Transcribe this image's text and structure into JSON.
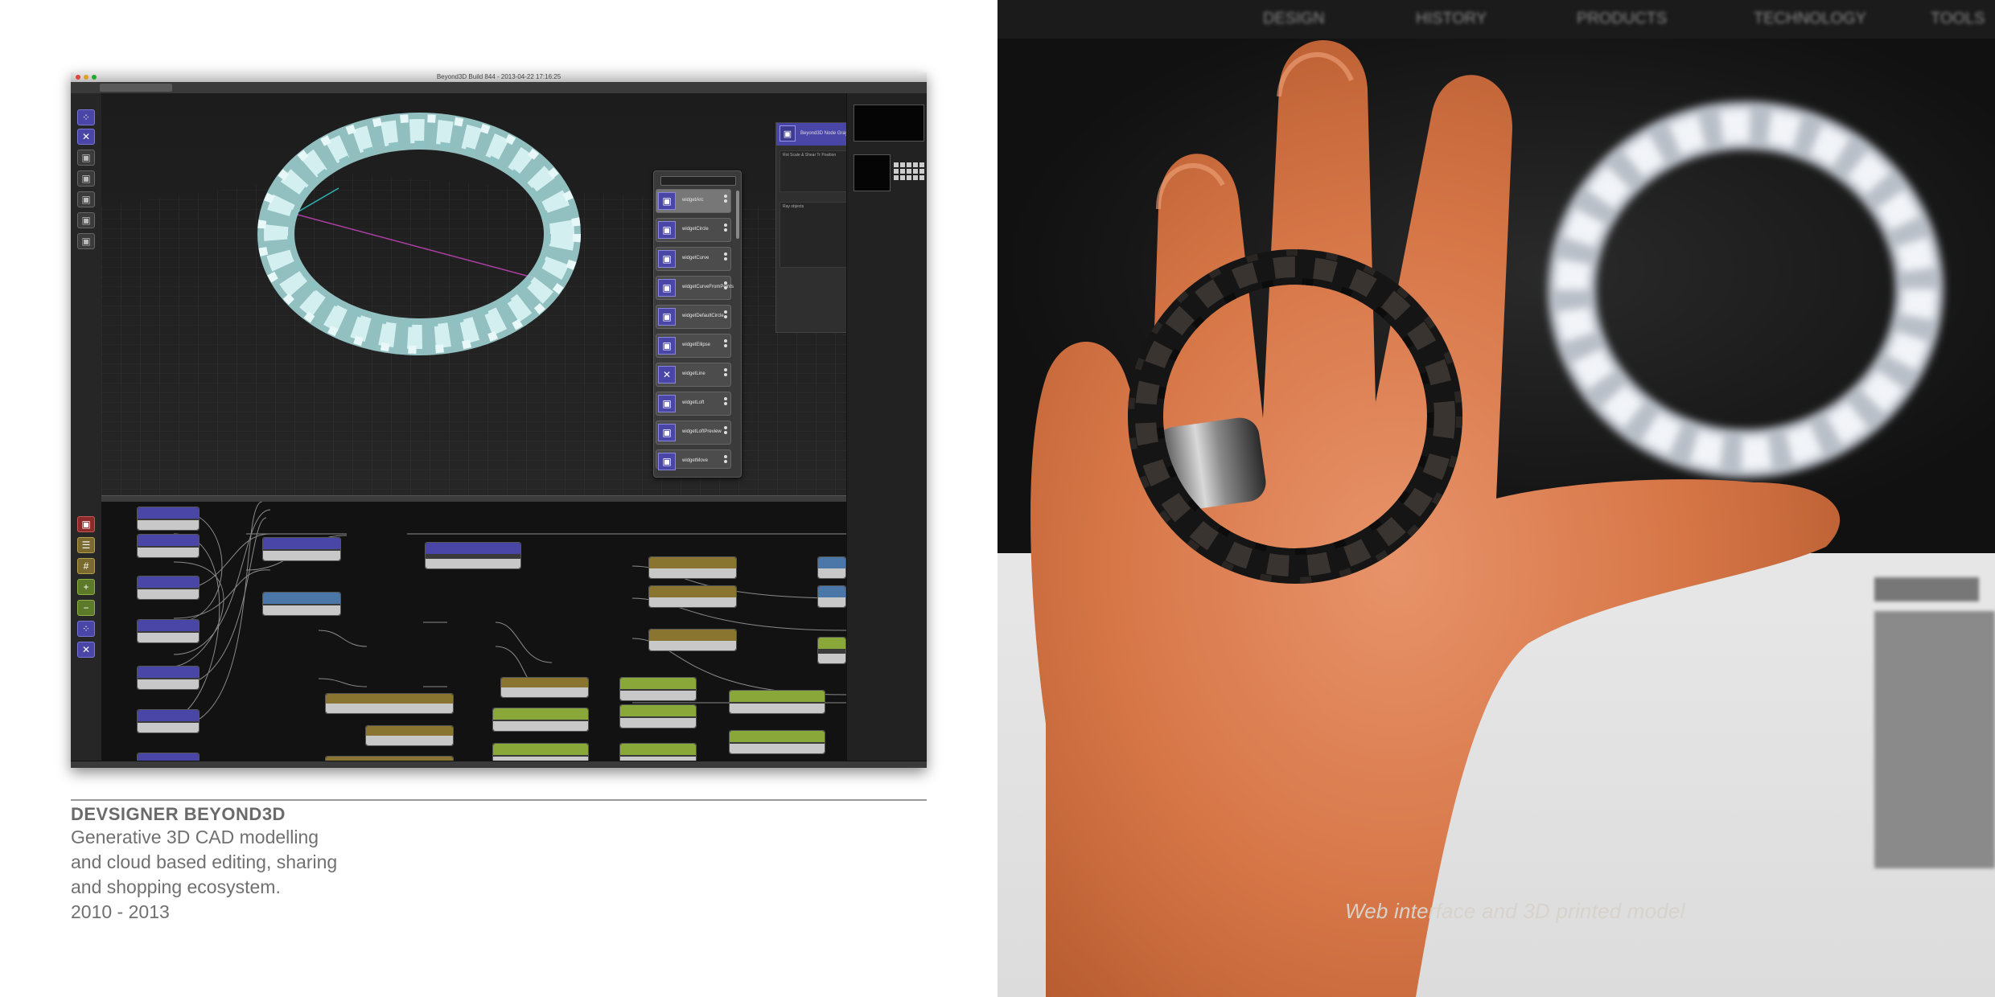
{
  "app": {
    "window_title": "Beyond3D Build 844 - 2013-04-22 17:16:25",
    "props_panel_title": "Beyond3D Node Gray",
    "props_section_1": "Rot Scale & Shear Tr Position",
    "props_section_2": "Ray objects",
    "widget_list": [
      "widgetArc",
      "widgetCircle",
      "widgetCurve",
      "widgetCurveFromPoints",
      "widgetDefaultCircle",
      "widgetEllipse",
      "widgetLine",
      "widgetLoft",
      "widgetLoftPreview",
      "widgetMove"
    ],
    "colors": {
      "blue_node": "#4a46a8",
      "gold_node": "#8a7530",
      "green_node": "#8aa83a",
      "model": "#bfe6e6"
    }
  },
  "caption": {
    "title": "DEVSIGNER BEYOND3D",
    "line1": "Generative   3D   CAD   modelling",
    "line2": "and cloud based editing, sharing",
    "line3": "and shopping ecosystem.",
    "years": "2010 - 2013"
  },
  "photo": {
    "nav": [
      "DESIGN",
      "HISTORY",
      "PRODUCTS",
      "TECHNOLOGY",
      "TOOLS"
    ],
    "caption": "Web interface and 3D printed model"
  }
}
